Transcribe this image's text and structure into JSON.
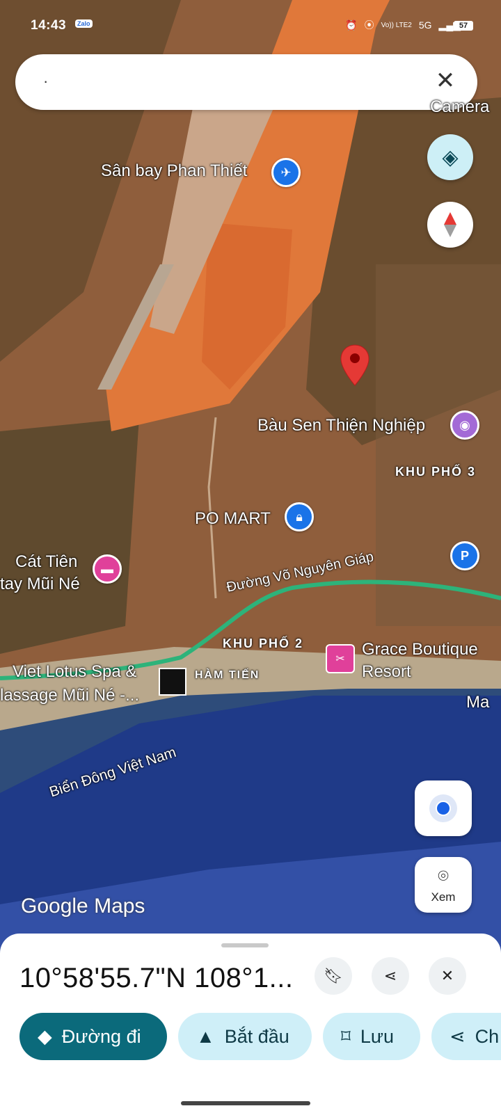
{
  "status_bar": {
    "time": "14:43",
    "app_badge": "Zalo",
    "network": "Vo)) LTE2",
    "net_type": "5G",
    "battery": "57"
  },
  "search": {
    "query": "·",
    "clear_icon": "close-icon"
  },
  "side_buttons": {
    "layers_icon": "layers-icon",
    "compass_icon": "compass-icon",
    "locate_icon": "my-location-icon",
    "lens_label": "Xem"
  },
  "map_labels": {
    "airport": "Sân bay Phan Thiết",
    "bau_sen": "Bàu Sen Thiện Nghiệp",
    "khu_pho_3": "KHU PHỐ 3",
    "po_mart": "PO MART",
    "cat_tien_line1": "Cát Tiên",
    "cat_tien_line2": "tay Mũi Né",
    "road": "Đường Võ Nguyên Giáp",
    "khu_pho_2": "KHU PHỐ 2",
    "grace_line1": "Grace Boutique",
    "grace_line2": "Resort",
    "viet_lotus_line1": "Viet Lotus Spa &",
    "viet_lotus_line2": "lassage Mũi Né -...",
    "ham_tien": "HÀM TIẾN",
    "sea": "Biển Đông Việt Nam",
    "camera_partial": "Camera",
    "ma_partial": "Ma",
    "logo": "Google Maps"
  },
  "place_sheet": {
    "coordinates": "10°58'55.7\"N 108°1...",
    "save_icon": "bookmark-icon",
    "share_icon": "share-icon",
    "close_icon": "close-icon"
  },
  "actions": {
    "directions": "Đường đi",
    "start": "Bắt đầu",
    "save": "Lưu",
    "share": "Ch"
  },
  "colors": {
    "primary": "#0b6a7b",
    "chip": "#cfeff8",
    "pin_red": "#e53935",
    "road": "#2db37a"
  }
}
